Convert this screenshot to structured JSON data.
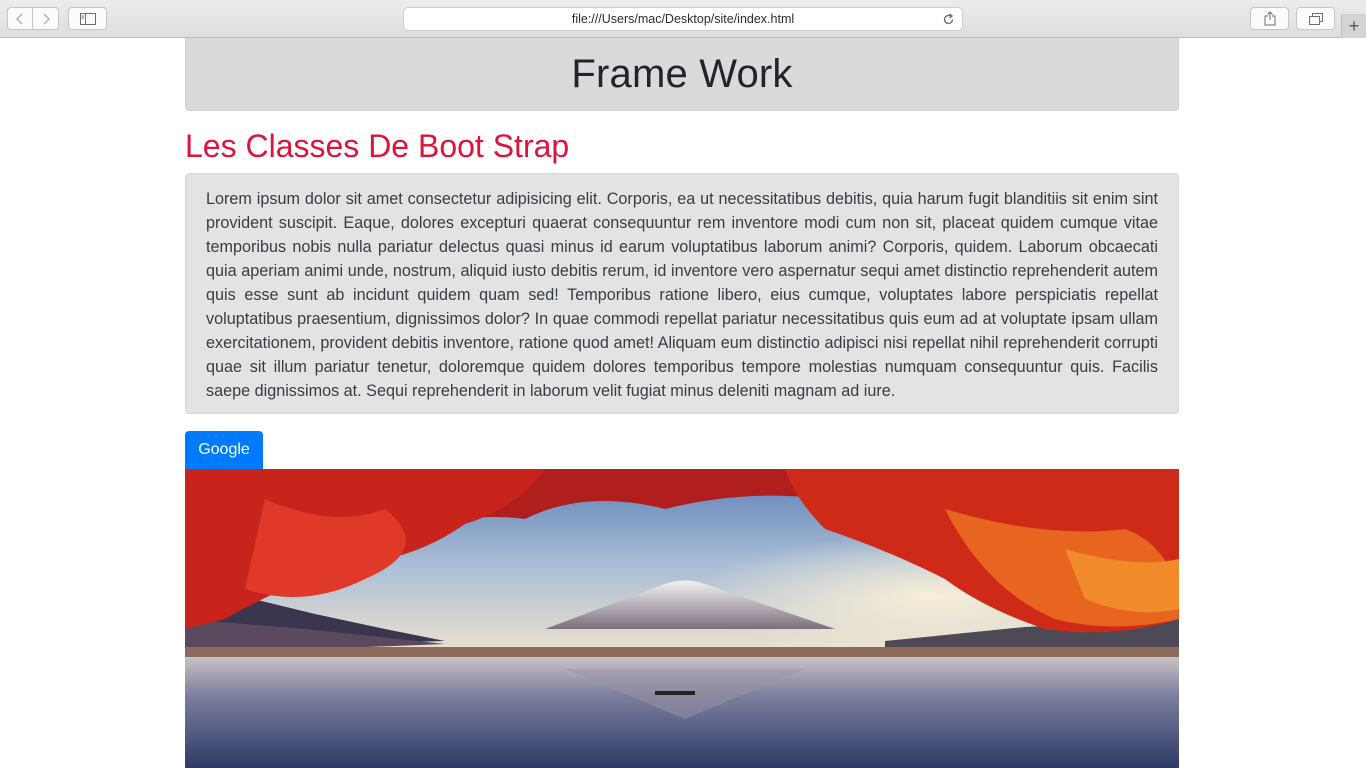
{
  "browser": {
    "url": "file:///Users/mac/Desktop/site/index.html",
    "icons": {
      "back": "chevron-left-icon",
      "forward": "chevron-right-icon",
      "sidebar": "sidebar-icon",
      "reload": "reload-icon",
      "share": "share-icon",
      "tabs": "tabs-overview-icon",
      "new_tab": "plus-icon"
    }
  },
  "page": {
    "jumbotron_title": "Frame Work",
    "section_title": "Les Classes De Boot Strap",
    "paragraph": "Lorem ipsum dolor sit amet consectetur adipisicing elit. Corporis, ea ut necessitatibus debitis, quia harum fugit blanditiis sit enim sint provident suscipit. Eaque, dolores excepturi quaerat consequuntur rem inventore modi cum non sit, placeat quidem cumque vitae temporibus nobis nulla pariatur delectus quasi minus id earum voluptatibus laborum animi? Corporis, quidem. Laborum obcaecati quia aperiam animi unde, nostrum, aliquid iusto debitis rerum, id inventore vero aspernatur sequi amet distinctio reprehenderit autem quis esse sunt ab incidunt quidem quam sed! Temporibus ratione libero, eius cumque, voluptates labore perspiciatis repellat voluptatibus praesentium, dignissimos dolor? In quae commodi repellat pariatur necessitatibus quis eum ad at voluptate ipsam ullam exercitationem, provident debitis inventore, ratione quod amet! Aliquam eum distinctio adipisci nisi repellat nihil reprehenderit corrupti quae sit illum pariatur tenetur, doloremque quidem dolores temporibus tempore molestias numquam consequuntur quis. Facilis saepe dignissimos at. Sequi reprehenderit in laborum velit fugiat minus deleniti magnam ad iure.",
    "button_label": "Google",
    "colors": {
      "section_title": "#dc143c",
      "button": "#007bff",
      "jumbotron_bg": "#d9dadc",
      "well_bg": "#e2e3e5"
    }
  }
}
